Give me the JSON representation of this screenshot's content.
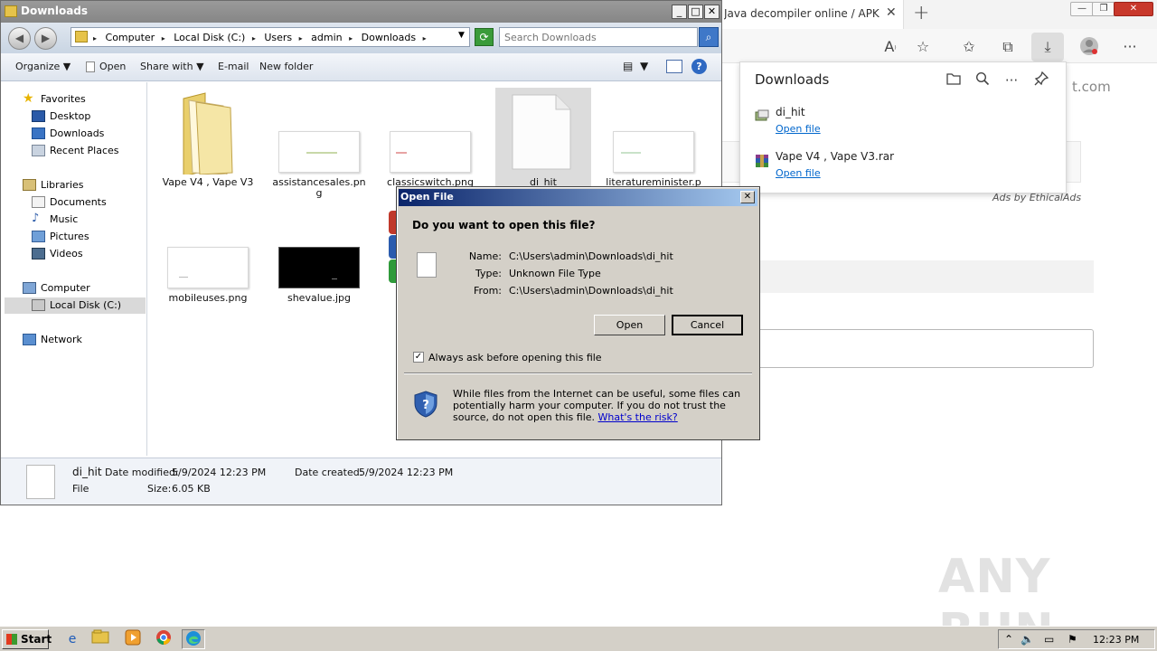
{
  "browser": {
    "tab_title": "Java decompiler online / APK dec",
    "tab_close": "✕",
    "new_tab": "+",
    "window_controls": {
      "minimize": "—",
      "maximize": "❐",
      "close": "✕"
    },
    "toolbar_icons": [
      "read-aloud-icon",
      "add-favorite-icon",
      "favorites-icon",
      "collections-icon",
      "downloads-icon",
      "profile-icon",
      "more-icon"
    ],
    "partial_text": "t.com",
    "ads_text": "Ads by EthicalAds",
    "watermark": "ANY RUN"
  },
  "downloads_panel": {
    "title": "Downloads",
    "items": [
      {
        "name": "di_hit",
        "action": "Open file"
      },
      {
        "name": "Vape V4 , Vape V3.rar",
        "action": "Open file"
      }
    ]
  },
  "explorer": {
    "title": "Downloads",
    "breadcrumbs": [
      "Computer",
      "Local Disk (C:)",
      "Users",
      "admin",
      "Downloads"
    ],
    "search_placeholder": "Search Downloads",
    "commands": {
      "organize": "Organize ▼",
      "open": "Open",
      "share": "Share with ▼",
      "email": "E-mail",
      "new_folder": "New folder"
    },
    "nav": {
      "favorites": "Favorites",
      "desktop": "Desktop",
      "downloads": "Downloads",
      "recent": "Recent Places",
      "libraries": "Libraries",
      "documents": "Documents",
      "music": "Music",
      "pictures": "Pictures",
      "videos": "Videos",
      "computer": "Computer",
      "local_disk": "Local Disk (C:)",
      "network": "Network"
    },
    "files": [
      {
        "name": "Vape V4 , Vape V3"
      },
      {
        "name": "assistancesales.png"
      },
      {
        "name": "classicswitch.png"
      },
      {
        "name": "di_hit"
      },
      {
        "name": "literatureminister.p"
      },
      {
        "name": "mobileuses.png"
      },
      {
        "name": "shevalue.jpg"
      }
    ],
    "details": {
      "name": "di_hit",
      "modified_label": "Date modified:",
      "modified_value": "5/9/2024 12:23 PM",
      "created_label": "Date created:",
      "created_value": "5/9/2024 12:23 PM",
      "type": "File",
      "size_label": "Size:",
      "size_value": "6.05 KB"
    }
  },
  "dialog": {
    "title": "Open File",
    "question": "Do you want to open this file?",
    "name_label": "Name:",
    "name_value": "C:\\Users\\admin\\Downloads\\di_hit",
    "type_label": "Type:",
    "type_value": "Unknown File Type",
    "from_label": "From:",
    "from_value": "C:\\Users\\admin\\Downloads\\di_hit",
    "open_button": "Open",
    "cancel_button": "Cancel",
    "always_ask": "Always ask before opening this file",
    "always_ask_checked": true,
    "warning": "While files from the Internet can be useful, some files can potentially harm your computer. If you do not trust the source, do not open this file.",
    "risk_link": "What's the risk?"
  },
  "taskbar": {
    "start": "Start",
    "clock": "12:23 PM"
  }
}
